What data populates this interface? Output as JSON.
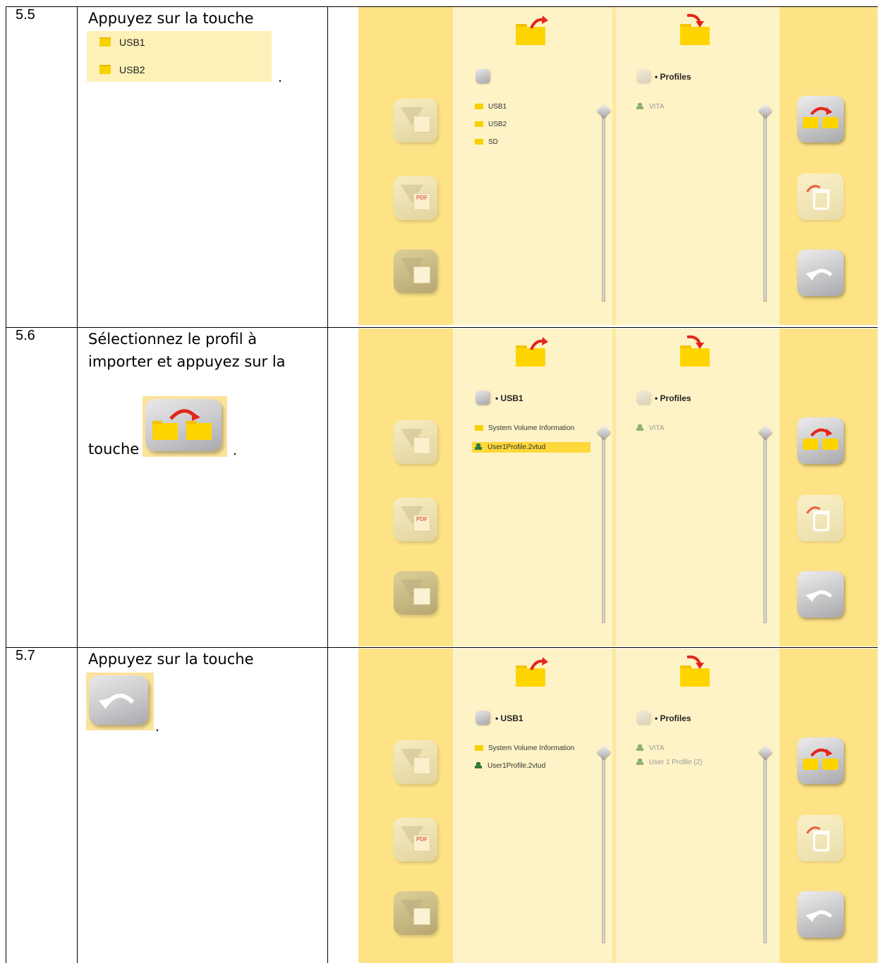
{
  "rows": [
    {
      "number": "5.5",
      "text": "Appuyez sur la touche",
      "trailing": ".",
      "inline_list": [
        "USB1",
        "USB2"
      ]
    },
    {
      "number": "5.6",
      "text": "Sélectionnez le profil à importer et appuyez sur la",
      "text2": "touche",
      "trailing": "."
    },
    {
      "number": "5.7",
      "text": "Appuyez sur la touche",
      "trailing": "."
    }
  ],
  "screens": [
    {
      "left_path": "",
      "right_path": "• Profiles",
      "left_items": [
        {
          "label": "USB1",
          "kind": "folder"
        },
        {
          "label": "USB2",
          "kind": "folder"
        },
        {
          "label": "SD",
          "kind": "folder"
        }
      ],
      "right_items": [
        {
          "label": "VITA",
          "kind": "profile"
        }
      ]
    },
    {
      "left_path": "• USB1",
      "right_path": "• Profiles",
      "left_items": [
        {
          "label": "System Volume Information",
          "kind": "folder"
        },
        {
          "label": "User1Profile.2vtud",
          "kind": "profile",
          "selected": true
        }
      ],
      "right_items": [
        {
          "label": "VITA",
          "kind": "profile"
        }
      ]
    },
    {
      "left_path": "• USB1",
      "right_path": "• Profiles",
      "left_items": [
        {
          "label": "System Volume Information",
          "kind": "folder"
        },
        {
          "label": "User1Profile.2vtud",
          "kind": "profile"
        }
      ],
      "right_items": [
        {
          "label": "VITA",
          "kind": "profile"
        },
        {
          "label": "User 1 Profile (2)",
          "kind": "profile"
        }
      ]
    }
  ],
  "icons": {
    "pdf_label": "PDF",
    "source_folder": "folder-export-icon",
    "target_folder": "folder-import-icon",
    "import_button": "import-folders-icon",
    "delete_button": "trash-icon",
    "back_button": "back-arrow-icon"
  },
  "colors": {
    "panel_yellow": "#fde386",
    "list_bg": "#fef3c6",
    "folder": "#ffd500",
    "arrow_red": "#e2261a",
    "profile_green": "#2f7a3a",
    "selection": "#ffd83a"
  }
}
